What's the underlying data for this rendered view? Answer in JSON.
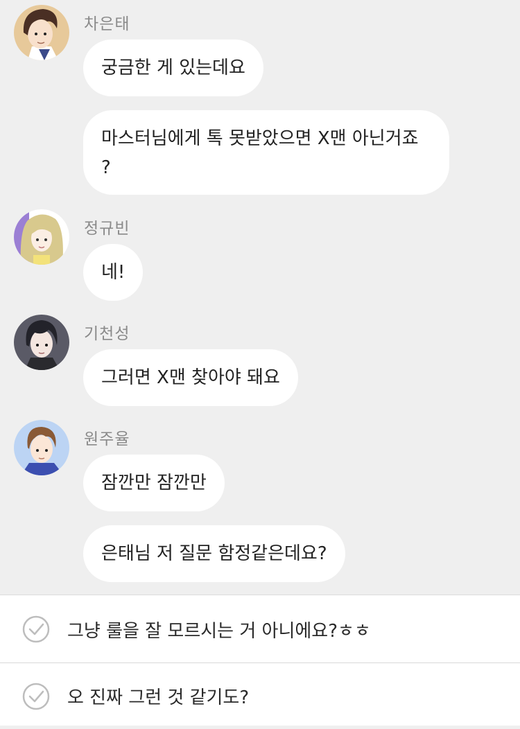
{
  "messages": [
    {
      "sender": "차은태",
      "avatar_icon": "avatar-boy-brown-hair-icon",
      "bubbles": [
        "궁금한 게 있는데요",
        "마스터님에게 톡 못받았으면 X맨 아닌거죠\n?"
      ]
    },
    {
      "sender": "정규빈",
      "avatar_icon": "avatar-girl-blonde-hair-icon",
      "bubbles": [
        "네!"
      ]
    },
    {
      "sender": "기천성",
      "avatar_icon": "avatar-boy-dark-hair-icon",
      "bubbles": [
        "그러면 X맨 찾아야 돼요"
      ]
    },
    {
      "sender": "원주율",
      "avatar_icon": "avatar-boy-blue-background-icon",
      "bubbles": [
        "잠깐만 잠깐만",
        "은태님 저 질문 함정같은데요?"
      ]
    }
  ],
  "options": [
    {
      "label": "그냥 룰을 잘 모르시는 거 아니에요?ㅎㅎ",
      "icon": "check-circle-icon"
    },
    {
      "label": "오 진짜 그런 것 같기도?",
      "icon": "check-circle-icon"
    }
  ],
  "colors": {
    "chat_background": "#efefef",
    "bubble": "#ffffff",
    "sender_text": "#8a8a8a",
    "message_text": "#222222",
    "check_icon": "#bdbdbd"
  }
}
